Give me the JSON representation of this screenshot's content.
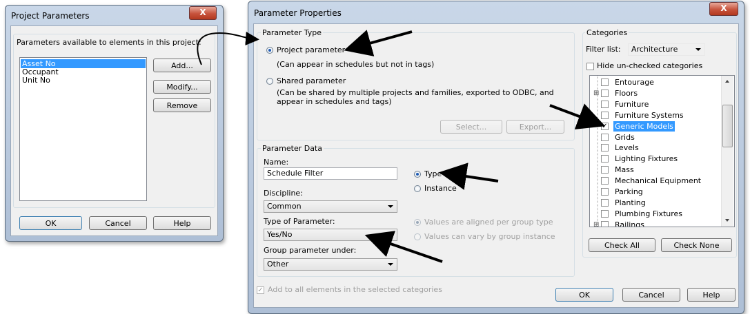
{
  "project_parameters": {
    "title": "Project Parameters",
    "close": "X",
    "list_label": "Parameters available to elements in this project:",
    "items": [
      "Asset No",
      "Occupant",
      "Unit No"
    ],
    "add_label": "Add...",
    "modify_label": "Modify...",
    "remove_label": "Remove",
    "ok_label": "OK",
    "cancel_label": "Cancel",
    "help_label": "Help"
  },
  "parameter_properties": {
    "title": "Parameter Properties",
    "close": "X",
    "parameter_type": {
      "group_label": "Parameter Type",
      "project_parameter": "Project parameter",
      "project_note": "(Can appear in schedules but not in tags)",
      "shared_parameter": "Shared parameter",
      "shared_note_line1": "(Can be shared by multiple projects and families, exported to ODBC, and",
      "shared_note_line2": "appear in schedules and tags)",
      "select_label": "Select...",
      "export_label": "Export..."
    },
    "parameter_data": {
      "group_label": "Parameter Data",
      "name_label": "Name:",
      "name_value": "Schedule Filter",
      "type_label": "Type",
      "instance_label": "Instance",
      "discipline_label": "Discipline:",
      "discipline_value": "Common",
      "type_of_parameter_label": "Type of Parameter:",
      "type_of_parameter_value": "Yes/No",
      "aligned_label": "Values are aligned per group type",
      "vary_label": "Values can vary by group instance",
      "group_under_label": "Group parameter under:",
      "group_under_value": "Other"
    },
    "add_all_label": "Add to all elements in the selected categories",
    "categories": {
      "group_label": "Categories",
      "filter_label": "Filter list:",
      "filter_value": "Architecture",
      "hide_label": "Hide un-checked categories",
      "items": [
        {
          "label": "Entourage",
          "checked": false
        },
        {
          "label": "Floors",
          "checked": false,
          "expandable": true
        },
        {
          "label": "Furniture",
          "checked": false
        },
        {
          "label": "Furniture Systems",
          "checked": false
        },
        {
          "label": "Generic Models",
          "checked": true,
          "selected": true
        },
        {
          "label": "Grids",
          "checked": false
        },
        {
          "label": "Levels",
          "checked": false
        },
        {
          "label": "Lighting Fixtures",
          "checked": false
        },
        {
          "label": "Mass",
          "checked": false
        },
        {
          "label": "Mechanical Equipment",
          "checked": false
        },
        {
          "label": "Parking",
          "checked": false
        },
        {
          "label": "Planting",
          "checked": false
        },
        {
          "label": "Plumbing Fixtures",
          "checked": false
        },
        {
          "label": "Railings",
          "checked": false,
          "expandable": true
        }
      ],
      "check_all_label": "Check All",
      "check_none_label": "Check None"
    },
    "ok_label": "OK",
    "cancel_label": "Cancel",
    "help_label": "Help"
  }
}
